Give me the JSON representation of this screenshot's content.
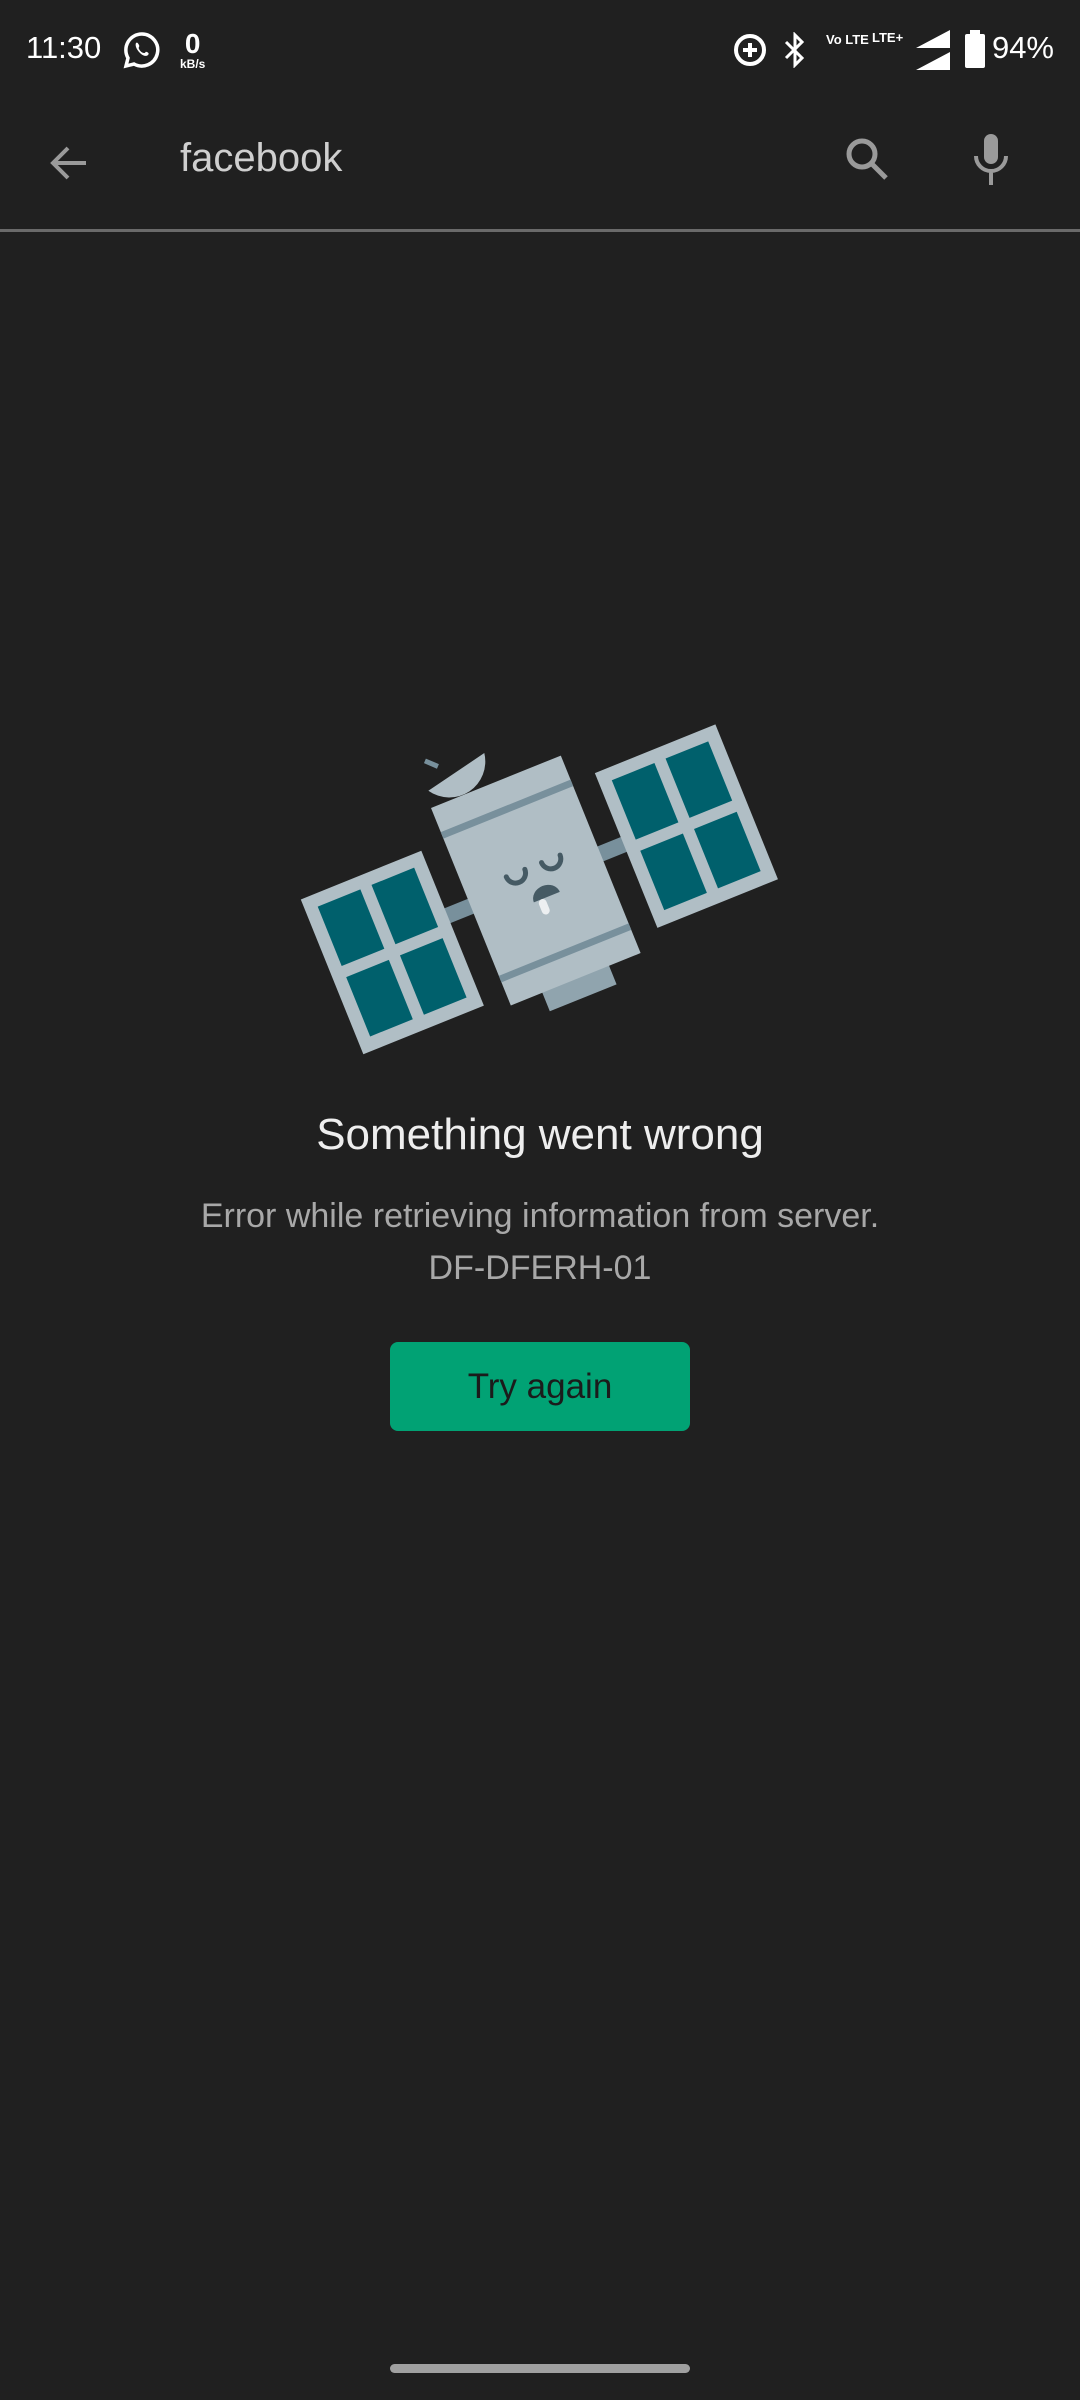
{
  "status_bar": {
    "time": "11:30",
    "net_speed_value": "0",
    "net_speed_unit": "kB/s",
    "volte_label": "Vo LTE",
    "lte_label": "LTE+",
    "battery": "94%",
    "icons": [
      "whatsapp-icon",
      "data-saver-icon",
      "bluetooth-icon",
      "volte-icon",
      "signal-icon",
      "battery-icon"
    ]
  },
  "search_bar": {
    "query": "facebook",
    "icons": [
      "back-arrow-icon",
      "search-icon",
      "mic-icon"
    ]
  },
  "error": {
    "title": "Something went wrong",
    "message": "Error while retrieving information from server.",
    "code": "DF-DFERH-01",
    "illustration": "sleeping-satellite"
  },
  "retry_button": {
    "label": "Try again"
  },
  "colors": {
    "background": "#202020",
    "accent": "#01a274",
    "panel": "#00606c",
    "satellite": "#b0bec5"
  }
}
